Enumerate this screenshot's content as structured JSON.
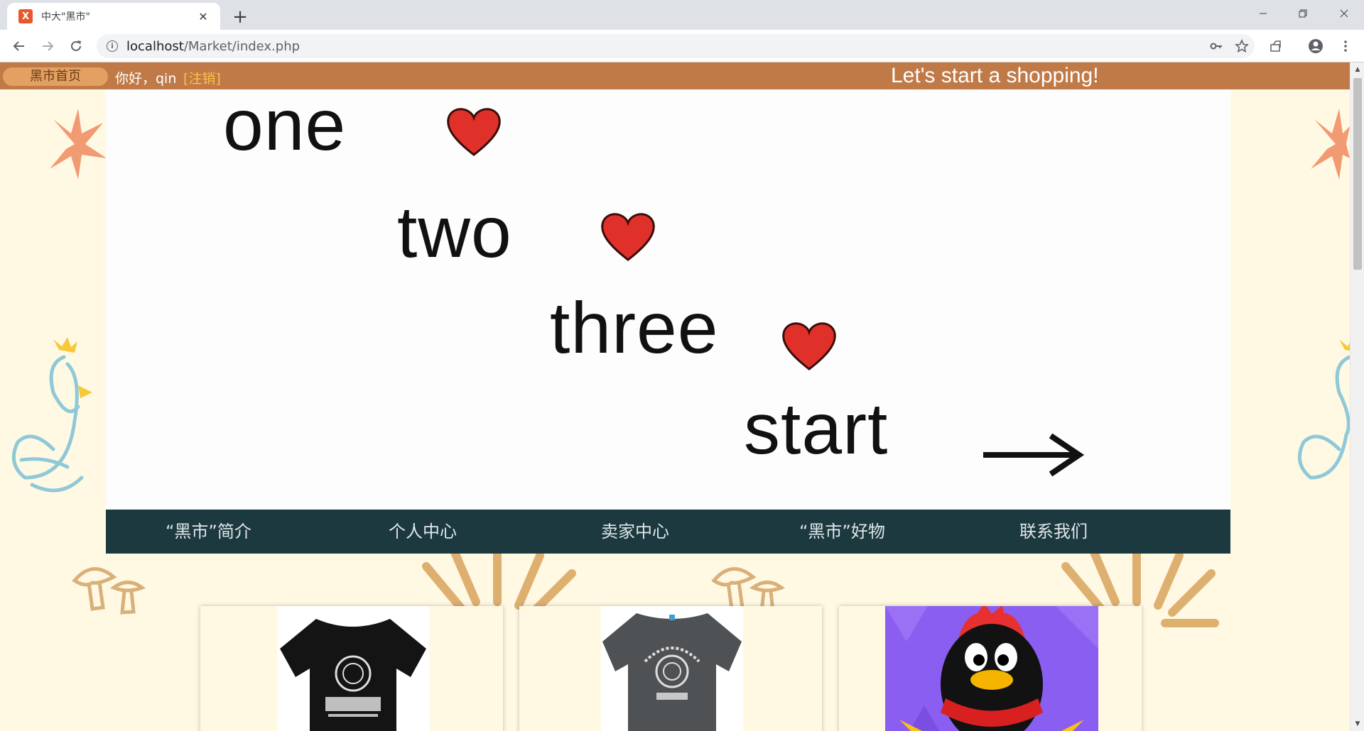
{
  "browser": {
    "tab_title": "中大\"黑市\"",
    "tab_favicon": "X",
    "new_tab_label": "+",
    "url_host": "localhost",
    "url_path": "/Market/index.php"
  },
  "site": {
    "home_label": "黑市首页",
    "greeting": "你好，qin",
    "logout_label": "[注销]",
    "slogan": "Let's start a shopping!"
  },
  "banner": {
    "words": [
      "one",
      "two",
      "three",
      "start"
    ]
  },
  "nav": {
    "items": [
      "“黑市”简介",
      "个人中心",
      "卖家中心",
      "“黑市”好物",
      "联系我们"
    ]
  },
  "colors": {
    "site_bar": "#c07a48",
    "nav": "#1c393f",
    "page_bg": "#fff9e3",
    "heart": "#e0302a"
  },
  "products": [
    {
      "name": "black-tshirt",
      "icon": "tshirt-black"
    },
    {
      "name": "gray-tshirt",
      "icon": "tshirt-gray"
    },
    {
      "name": "qq-penguin",
      "icon": "penguin"
    }
  ]
}
